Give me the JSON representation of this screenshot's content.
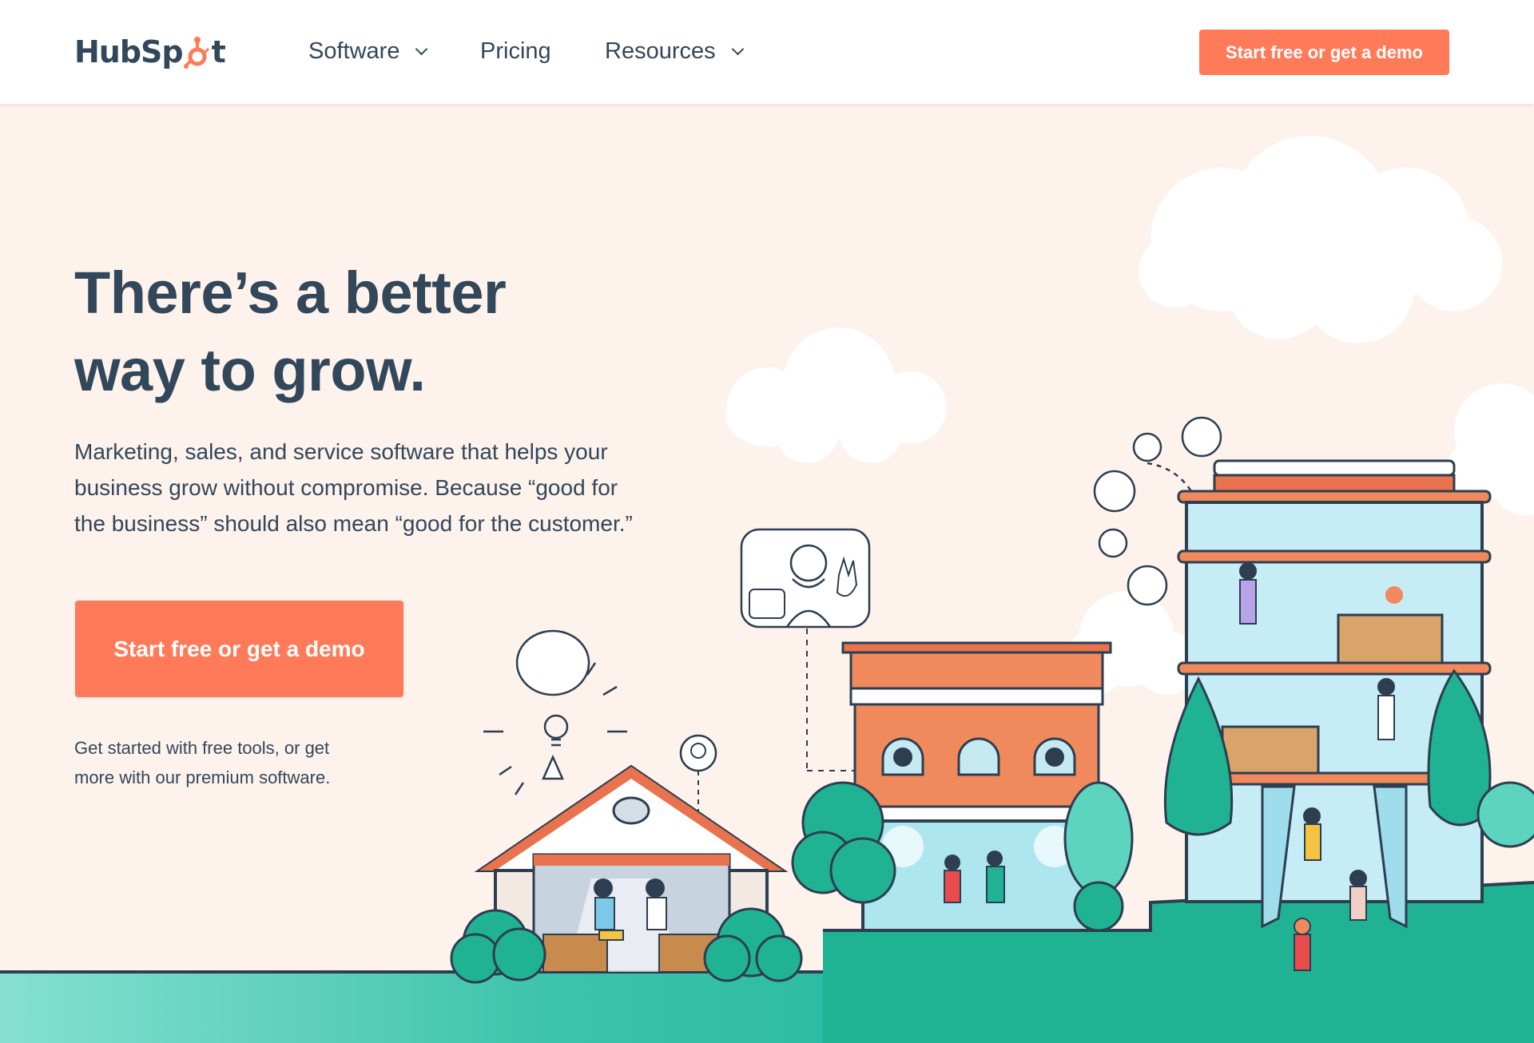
{
  "brand": {
    "logo_text_before": "HubSp",
    "logo_text_after": "t",
    "accent": "#ff7a59",
    "text_color": "#33475b",
    "teal": "#00bda5"
  },
  "nav": {
    "items": [
      {
        "label": "Software",
        "has_dropdown": true
      },
      {
        "label": "Pricing",
        "has_dropdown": false
      },
      {
        "label": "Resources",
        "has_dropdown": true
      }
    ],
    "cta_label": "Start free or get a demo"
  },
  "hero": {
    "title_line1": "There’s a better",
    "title_line2": "way to grow.",
    "description": "Marketing, sales, and service software that helps your business grow without compromise. Because “good for the business” should also mean “good for the customer.”",
    "cta_label": "Start free or get a demo",
    "note_line1": "Get started with free tools, or get",
    "note_line2": "more with our premium software."
  },
  "illustration": {
    "icons": [
      "cloud-icon",
      "lightbulb-icon",
      "video-call-icon",
      "person-avatar-icon",
      "house-icon",
      "brick-building-icon",
      "glass-tower-icon",
      "tree-icon"
    ]
  }
}
